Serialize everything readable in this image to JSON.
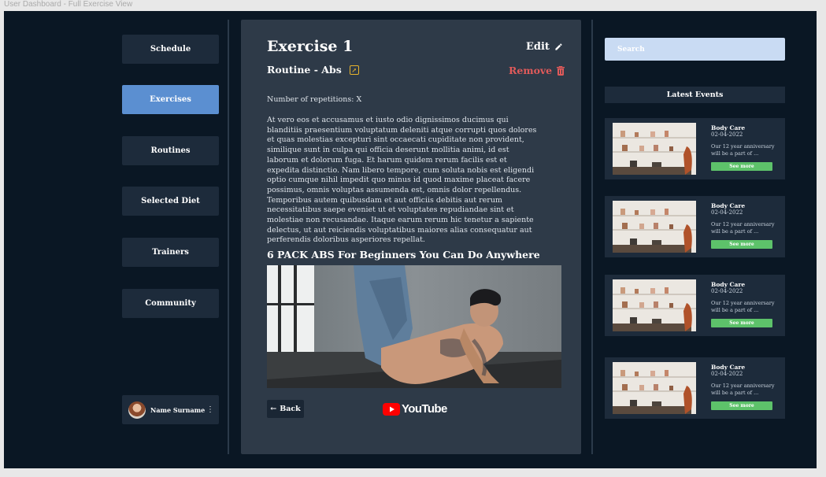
{
  "frame_title": "User Dashboard - Full Exercise View",
  "nav": {
    "items": [
      {
        "label": "Schedule"
      },
      {
        "label": "Exercises",
        "active": true
      },
      {
        "label": "Routines"
      },
      {
        "label": "Selected Diet"
      },
      {
        "label": "Trainers"
      },
      {
        "label": "Community"
      }
    ]
  },
  "user": {
    "name": "Name Surname",
    "menu_icon": "more-vertical-icon"
  },
  "exercise": {
    "title": "Exercise 1",
    "edit_label": "Edit",
    "routine_label": "Routine - Abs",
    "remove_label": "Remove",
    "repetitions_text": "Number of repetitions: X",
    "description": "At vero eos et accusamus et iusto odio dignissimos ducimus qui blanditiis praesentium voluptatum deleniti atque corrupti quos dolores et quas molestias excepturi sint occaecati cupiditate non provident, similique sunt in culpa qui officia deserunt mollitia animi, id est laborum et dolorum fuga. Et harum quidem rerum facilis est et expedita distinctio. Nam libero tempore, cum soluta nobis est eligendi optio cumque nihil impedit quo minus id quod maxime placeat facere possimus, omnis voluptas assumenda est, omnis dolor repellendus. Temporibus autem quibusdam et aut officiis debitis aut rerum necessitatibus saepe eveniet ut et voluptates repudiandae sint et molestiae non recusandae. Itaque earum rerum hic tenetur a sapiente delectus, ut aut reiciendis voluptatibus maiores alias consequatur aut perferendis doloribus asperiores repellat.",
    "video_title": "6 PACK ABS For Beginners You Can Do Anywhere",
    "back_label": "Back",
    "youtube_label": "YouTube"
  },
  "search": {
    "placeholder": "Search"
  },
  "events": {
    "header": "Latest Events",
    "items": [
      {
        "title": "Body Care",
        "date": "02-04-2022",
        "desc": "Our 12 year anniversary will be a part of ...",
        "button": "See more"
      },
      {
        "title": "Body Care",
        "date": "02-04-2022",
        "desc": "Our 12 year anniversary will be a part of ...",
        "button": "See more"
      },
      {
        "title": "Body Care",
        "date": "02-04-2022",
        "desc": "Our 12 year anniversary will be a part of ...",
        "button": "See more"
      },
      {
        "title": "Body Care",
        "date": "02-04-2022",
        "desc": "Our 12 year anniversary will be a part of ...",
        "button": "See more"
      }
    ]
  },
  "colors": {
    "background": "#0a1724",
    "panel": "#2e3a48",
    "nav_button": "#1d2b3b",
    "nav_active": "#5b8fd1",
    "remove": "#e05a5a",
    "accent_yellow": "#e8b42c",
    "see_more": "#5dc26a",
    "search_bg": "#c9dbf3",
    "youtube_red": "#ff0000"
  }
}
